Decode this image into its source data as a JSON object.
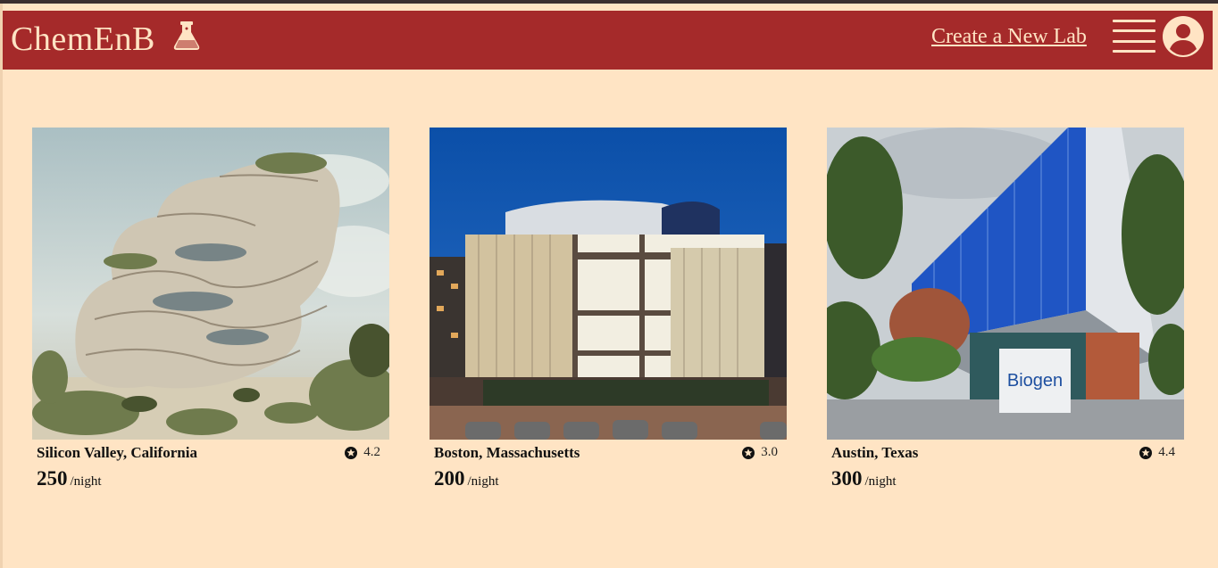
{
  "header": {
    "brand": "ChemEnB",
    "create_link": "Create a New Lab"
  },
  "colors": {
    "page_bg": "#FFE4C4",
    "navbar_bg": "#A52A2A",
    "navbar_text": "#FFE4C4"
  },
  "icons": {
    "brand": "flask-icon",
    "menu": "hamburger-menu-icon",
    "profile": "user-avatar-icon",
    "rating": "star-circle-icon"
  },
  "listings": [
    {
      "location": "Silicon Valley, California",
      "rating": "4.2",
      "price": "250",
      "unit": "/night",
      "image": "futuristic organic lab building among trees"
    },
    {
      "location": "Boston, Massachusetts",
      "rating": "3.0",
      "price": "200",
      "unit": "/night",
      "image": "illuminated glass lab building at dusk"
    },
    {
      "location": "Austin, Texas",
      "rating": "4.4",
      "price": "300",
      "unit": "/night",
      "image": "blue glass Biogen building"
    }
  ],
  "photo_sign_text": "Biogen"
}
